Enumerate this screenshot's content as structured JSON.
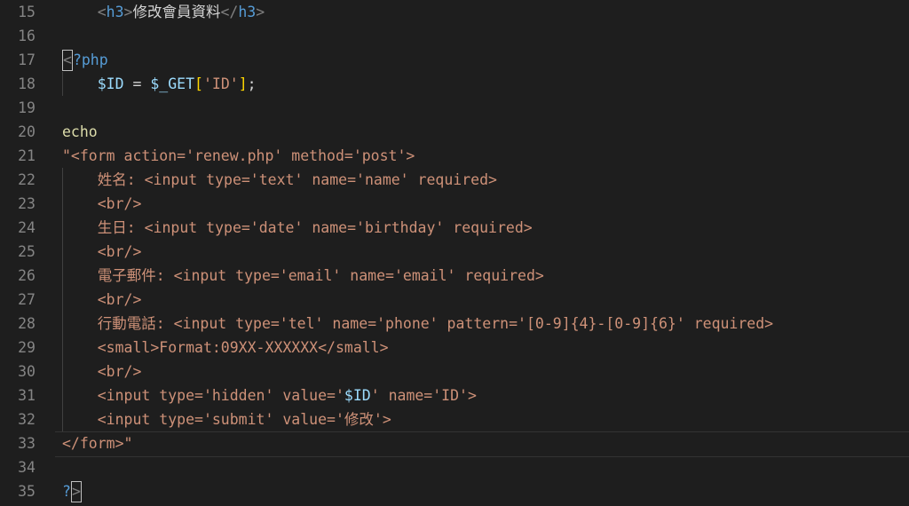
{
  "editor": {
    "lines": [
      {
        "num": "15",
        "t": [
          [
            "tag",
            "    <"
          ],
          [
            "tagname",
            "h3"
          ],
          [
            "tag",
            ">"
          ],
          [
            "text",
            "修改會員資料"
          ],
          [
            "tag",
            "</"
          ],
          [
            "tagname",
            "h3"
          ],
          [
            "tag",
            ">"
          ]
        ]
      },
      {
        "num": "16",
        "t": []
      },
      {
        "num": "17",
        "t": [
          [
            "cursorbox",
            "<"
          ],
          [
            "phpkw",
            "?php"
          ]
        ]
      },
      {
        "num": "18",
        "t": [
          [
            "text",
            "    "
          ],
          [
            "var",
            "$ID"
          ],
          [
            "punc",
            " = "
          ],
          [
            "var",
            "$_GET"
          ],
          [
            "bracket",
            "["
          ],
          [
            "str",
            "'ID'"
          ],
          [
            "bracket",
            "]"
          ],
          [
            "punc",
            ";"
          ]
        ]
      },
      {
        "num": "19",
        "t": []
      },
      {
        "num": "20",
        "t": [
          [
            "fn",
            "echo"
          ]
        ]
      },
      {
        "num": "21",
        "t": [
          [
            "str",
            "\"<form action='renew.php' method='post'>"
          ]
        ]
      },
      {
        "num": "22",
        "t": [
          [
            "str",
            "    姓名: <input type='text' name='name' required>"
          ]
        ]
      },
      {
        "num": "23",
        "t": [
          [
            "str",
            "    <br/>"
          ]
        ]
      },
      {
        "num": "24",
        "t": [
          [
            "str",
            "    生日: <input type='date' name='birthday' required>"
          ]
        ]
      },
      {
        "num": "25",
        "t": [
          [
            "str",
            "    <br/>"
          ]
        ]
      },
      {
        "num": "26",
        "t": [
          [
            "str",
            "    電子郵件: <input type='email' name='email' required>"
          ]
        ]
      },
      {
        "num": "27",
        "t": [
          [
            "str",
            "    <br/>"
          ]
        ]
      },
      {
        "num": "28",
        "t": [
          [
            "str",
            "    行動電話: <input type='tel' name='phone' pattern='[0-9]{4}-[0-9]{6}' required>"
          ]
        ]
      },
      {
        "num": "29",
        "t": [
          [
            "str",
            "    <small>Format:09XX-XXXXXX</small>"
          ]
        ]
      },
      {
        "num": "30",
        "t": [
          [
            "str",
            "    <br/>"
          ]
        ]
      },
      {
        "num": "31",
        "t": [
          [
            "str",
            "    <input type='hidden' value='"
          ],
          [
            "var",
            "$ID"
          ],
          [
            "str",
            "' name='ID'>"
          ]
        ]
      },
      {
        "num": "32",
        "t": [
          [
            "str",
            "    <input type='submit' value='修改'>"
          ]
        ]
      },
      {
        "num": "33",
        "t": [
          [
            "str",
            "</form>\""
          ]
        ]
      },
      {
        "num": "34",
        "t": []
      },
      {
        "num": "35",
        "t": [
          [
            "phpkw",
            "?"
          ],
          [
            "cursorbox",
            ">"
          ]
        ]
      }
    ]
  },
  "colors": {
    "background": "#1e1e1e",
    "line_number": "#858585",
    "string": "#ce9178",
    "variable": "#9cdcfe",
    "keyword": "#569cd6",
    "function": "#dcdcaa"
  }
}
